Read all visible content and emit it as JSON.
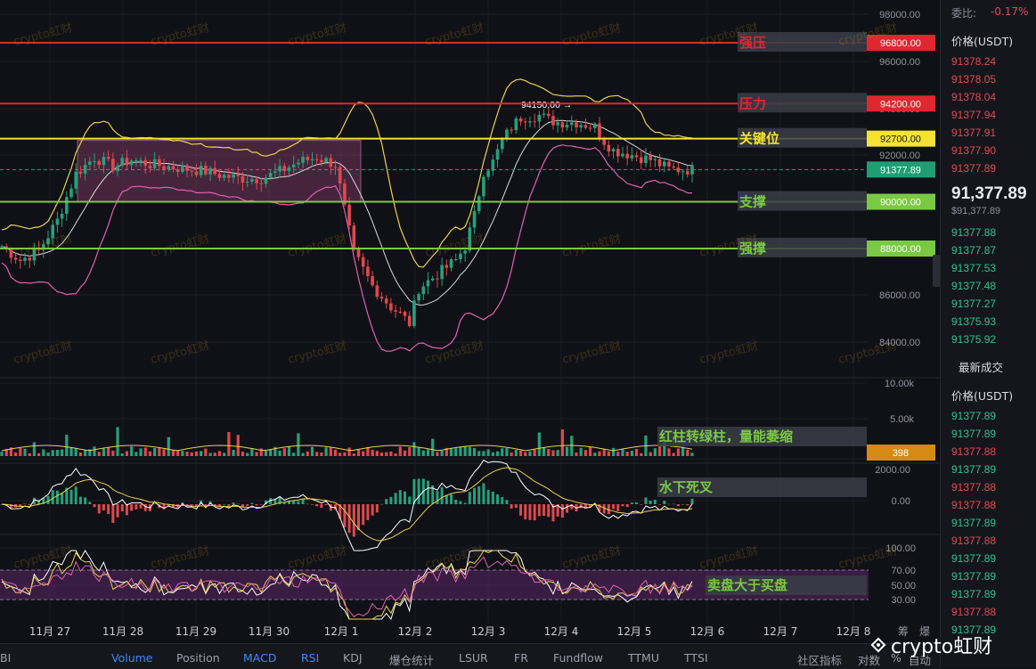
{
  "order_book": {
    "ratio_label": "委比:",
    "ratio_value": "-0.17%",
    "price_header": "价格(USDT)",
    "asks": [
      "91378.24",
      "91378.05",
      "91378.04",
      "91377.94",
      "91377.91",
      "91377.90",
      "91377.89"
    ],
    "last_price": "91,377.89",
    "last_price_sub": "$91,377.89",
    "bids": [
      "91377.88",
      "91377.87",
      "91377.53",
      "91377.48",
      "91377.27",
      "91375.93",
      "91375.92"
    ],
    "trades_header": "最新成交",
    "trades_price_header": "价格(USDT)",
    "trades": [
      {
        "p": "91377.89",
        "side": "buy"
      },
      {
        "p": "91377.89",
        "side": "buy"
      },
      {
        "p": "91377.88",
        "side": "sell"
      },
      {
        "p": "91377.89",
        "side": "buy"
      },
      {
        "p": "91377.88",
        "side": "sell"
      },
      {
        "p": "91377.88",
        "side": "sell"
      },
      {
        "p": "91377.89",
        "side": "buy"
      },
      {
        "p": "91377.88",
        "side": "sell"
      },
      {
        "p": "91377.89",
        "side": "buy"
      },
      {
        "p": "91377.89",
        "side": "buy"
      },
      {
        "p": "91377.89",
        "side": "buy"
      },
      {
        "p": "91377.88",
        "side": "sell"
      },
      {
        "p": "91377.89",
        "side": "buy"
      }
    ]
  },
  "bottom_tabs": [
    {
      "label": "BI",
      "active": false
    },
    {
      "label": "Volume",
      "active": true
    },
    {
      "label": "Position",
      "active": false
    },
    {
      "label": "MACD",
      "active": true
    },
    {
      "label": "RSI",
      "active": true
    },
    {
      "label": "KDJ",
      "active": false
    },
    {
      "label": "爆仓统计",
      "active": false
    },
    {
      "label": "LSUR",
      "active": false
    },
    {
      "label": "FR",
      "active": false
    },
    {
      "label": "Fundflow",
      "active": false
    },
    {
      "label": "TTMU",
      "active": false
    },
    {
      "label": "TTSI",
      "active": false
    }
  ],
  "bottom_right": {
    "indicator_label": "社区指标",
    "compare_label": "对数",
    "percent_label": "%",
    "auto_label": "自动"
  },
  "right_top_icons": [
    "筹",
    "爆"
  ],
  "brand": "crypto虹财",
  "watermark_text": "crypto虹财",
  "colors": {
    "up": "#26a17b",
    "down": "#e0484d",
    "resistance": "#e0272f",
    "key": "#f5e233",
    "support": "#7ac943"
  },
  "chart_data": {
    "type": "candlestick",
    "x_ticks": [
      "11月 27",
      "11月 28",
      "11月 29",
      "11月 30",
      "12月 1",
      "12月 2",
      "12月 3",
      "12月 4",
      "12月 5",
      "12月 6",
      "12月 7",
      "12月 8"
    ],
    "price_axis": {
      "ticks": [
        "98000.00",
        "96000.00",
        "94000.00",
        "92000.00",
        "86000.00",
        "84000.00"
      ]
    },
    "levels": [
      {
        "price": 96800,
        "label": "96800.00",
        "note": "强压",
        "color": "#e0272f"
      },
      {
        "price": 94200,
        "label": "94200.00",
        "note": "压力",
        "color": "#e0272f"
      },
      {
        "price": 92700,
        "label": "92700.00",
        "note": "关键位",
        "color": "#f5e233"
      },
      {
        "price": 90000,
        "label": "90000.00",
        "note": "支撑",
        "color": "#7ac943"
      },
      {
        "price": 88000,
        "label": "88000.00",
        "note": "强撑",
        "color": "#7ac943"
      }
    ],
    "last_price": {
      "price": 91377.89,
      "label": "91377.89"
    },
    "high_marker": {
      "label": "94150.00"
    },
    "consolidation_box": {
      "price_top": 92700,
      "price_bottom": 90000
    },
    "trend": [
      [
        0,
        88100
      ],
      [
        4,
        87500
      ],
      [
        8,
        87900
      ],
      [
        12,
        89200
      ],
      [
        16,
        91200
      ],
      [
        20,
        91900
      ],
      [
        24,
        91500
      ],
      [
        28,
        91800
      ],
      [
        32,
        91600
      ],
      [
        36,
        91500
      ],
      [
        40,
        91400
      ],
      [
        44,
        91300
      ],
      [
        48,
        91100
      ],
      [
        52,
        91000
      ],
      [
        56,
        91000
      ],
      [
        60,
        91300
      ],
      [
        64,
        91700
      ],
      [
        68,
        91900
      ],
      [
        72,
        91600
      ],
      [
        76,
        87800
      ],
      [
        80,
        86400
      ],
      [
        84,
        85500
      ],
      [
        86,
        85200
      ],
      [
        88,
        84800
      ],
      [
        90,
        86300
      ],
      [
        94,
        86900
      ],
      [
        98,
        87500
      ],
      [
        100,
        88100
      ],
      [
        102,
        89400
      ],
      [
        104,
        91300
      ],
      [
        106,
        91700
      ],
      [
        108,
        92600
      ],
      [
        110,
        93200
      ],
      [
        112,
        93600
      ],
      [
        116,
        93700
      ],
      [
        118,
        93500
      ],
      [
        120,
        93400
      ],
      [
        124,
        93400
      ],
      [
        128,
        93200
      ],
      [
        130,
        92600
      ],
      [
        132,
        92200
      ],
      [
        136,
        92000
      ],
      [
        140,
        91800
      ],
      [
        144,
        91400
      ],
      [
        147,
        91378
      ]
    ],
    "volume": {
      "axis_ticks": [
        "10.00k",
        "5.00k"
      ],
      "current": "398",
      "annotation": "红柱转绿柱，量能萎缩"
    },
    "macd": {
      "axis_ticks": [
        "2000.00",
        "0.00"
      ],
      "annotation": "水下死叉"
    },
    "rsi": {
      "axis_ticks": [
        "100.00",
        "70.00",
        "50.00",
        "30.00"
      ],
      "annotation": "卖盘大于买盘"
    }
  }
}
